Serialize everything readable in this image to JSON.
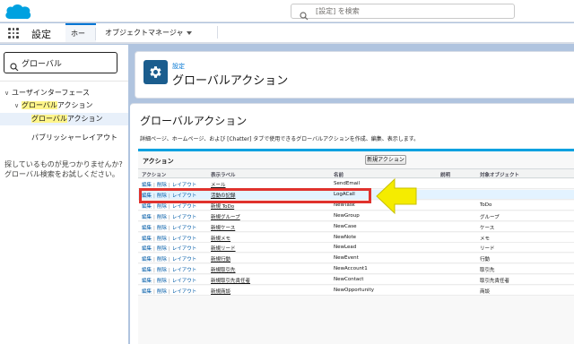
{
  "header": {
    "search_placeholder": "[設定] を検索",
    "brand_color": "#00a1e0"
  },
  "navbar": {
    "app_name": "設定",
    "tabs": [
      {
        "label": "ホーム",
        "active": true
      },
      {
        "label": "オブジェクトマネージャ",
        "active": false
      }
    ]
  },
  "sidebar": {
    "quickfind_value": "グローバル",
    "tree": {
      "user_interface": "ユーザインターフェース",
      "global_actions": {
        "pre": "",
        "hl": "グローバル",
        "post": "アクション"
      },
      "global_actions_child": {
        "pre": "",
        "hl": "グローバル",
        "post": "アクション"
      },
      "publisher_layout": "パブリッシャーレイアウト"
    },
    "not_found": "探しているものが見つかりませんか? グローバル検索をお試しください。"
  },
  "page_header": {
    "eyebrow": "設定",
    "title": "グローバルアクション",
    "icon": "gear-icon"
  },
  "content": {
    "title": "グローバルアクション",
    "description": "詳細ページ、ホームページ、および [Chatter] タブで使用できるグローバルアクションを作成、編集、表示します。",
    "table_title": "アクション",
    "new_button": "新規アクション",
    "columns": {
      "action": "アクション",
      "label": "表示ラベル",
      "name": "名前",
      "description": "説明",
      "object": "対象オブジェクト"
    },
    "row_actions": {
      "edit": "編集",
      "delete": "削除",
      "layout": "レイアウト",
      "sep": "|"
    },
    "rows": [
      {
        "label": "メール",
        "name": "SendEmail",
        "object": "",
        "highlighted": false
      },
      {
        "label": "活動の記録",
        "name": "LogACall",
        "object": "",
        "highlighted": true
      },
      {
        "label": "新規 ToDo",
        "name": "NewTask",
        "object": "ToDo",
        "highlighted": false
      },
      {
        "label": "新規グループ",
        "name": "NewGroup",
        "object": "グループ",
        "highlighted": false
      },
      {
        "label": "新規ケース",
        "name": "NewCase",
        "object": "ケース",
        "highlighted": false
      },
      {
        "label": "新規メモ",
        "name": "NewNote",
        "object": "メモ",
        "highlighted": false
      },
      {
        "label": "新規リード",
        "name": "NewLead",
        "object": "リード",
        "highlighted": false
      },
      {
        "label": "新規行動",
        "name": "NewEvent",
        "object": "行動",
        "highlighted": false
      },
      {
        "label": "新規取引先",
        "name": "NewAccount1",
        "object": "取引先",
        "highlighted": false
      },
      {
        "label": "新規取引先責任者",
        "name": "NewContact",
        "object": "取引先責任者",
        "highlighted": false
      },
      {
        "label": "新規商談",
        "name": "NewOpportunity",
        "object": "商談",
        "highlighted": false
      }
    ]
  },
  "annotations": {
    "highlight_color": "#e0322d",
    "arrow_color": "#f5ec00"
  }
}
